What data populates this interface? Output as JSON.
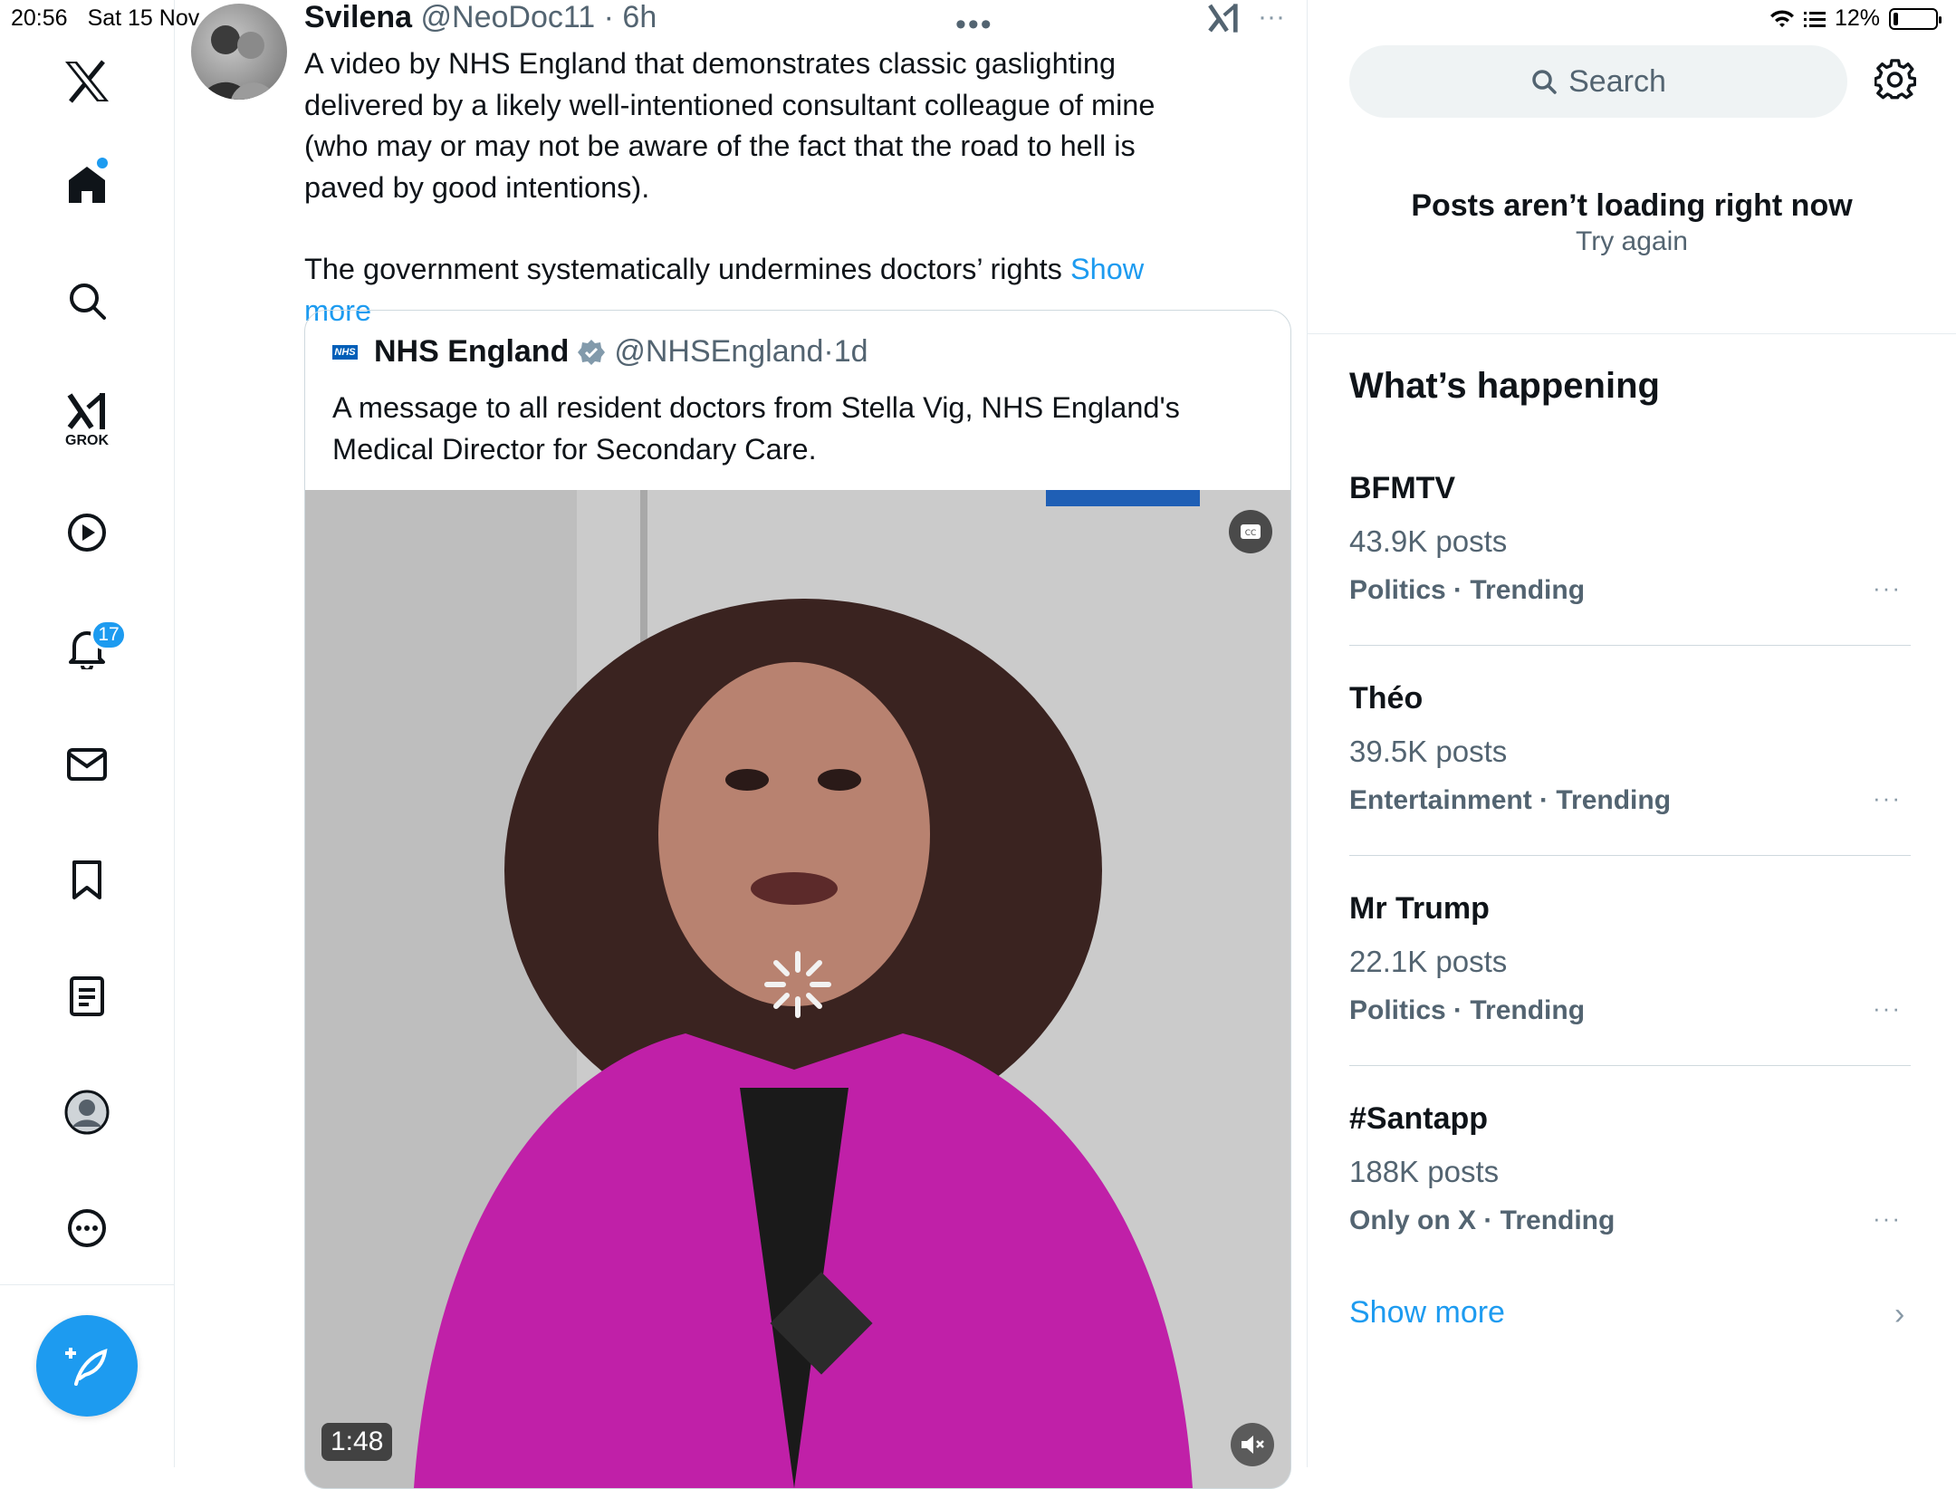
{
  "status_bar": {
    "time": "20:56",
    "date": "Sat 15 Nov",
    "battery": "12%",
    "battery_level": 0.12
  },
  "sidebar": {
    "notifications_badge": "17",
    "grok_label": "GROK"
  },
  "post": {
    "author_name": "Svilena",
    "author_handle": "@NeoDoc11",
    "time": "6h",
    "paragraph1": "A video by NHS England that demonstrates classic gaslighting delivered by a likely well-intentioned consultant colleague of mine (who may or may not be aware of the fact that the road to hell is paved by good intentions).",
    "paragraph2": "The government systematically undermines doctors’ rights",
    "show_more": "Show more",
    "quote": {
      "logo_text": "NHS",
      "author_name": "NHS England",
      "author_handle": "@NHSEngland",
      "time": "1d",
      "text": "A message to all resident doctors from Stella Vig, NHS England's Medical Director for Secondary Care.",
      "video_duration": "1:48"
    }
  },
  "right": {
    "search_placeholder": "Search",
    "notice_title": "Posts aren’t loading right now",
    "notice_retry": "Try again",
    "whats_happening": "What’s happening",
    "trends": [
      {
        "name": "BFMTV",
        "posts": "43.9K posts",
        "category": "Politics · Trending"
      },
      {
        "name": "Théo",
        "posts": "39.5K posts",
        "category": "Entertainment · Trending"
      },
      {
        "name": "Mr Trump",
        "posts": "22.1K posts",
        "category": "Politics · Trending"
      },
      {
        "name": "#Santapp",
        "posts": "188K posts",
        "category": "Only on X · Trending"
      }
    ],
    "show_more": "Show more"
  }
}
